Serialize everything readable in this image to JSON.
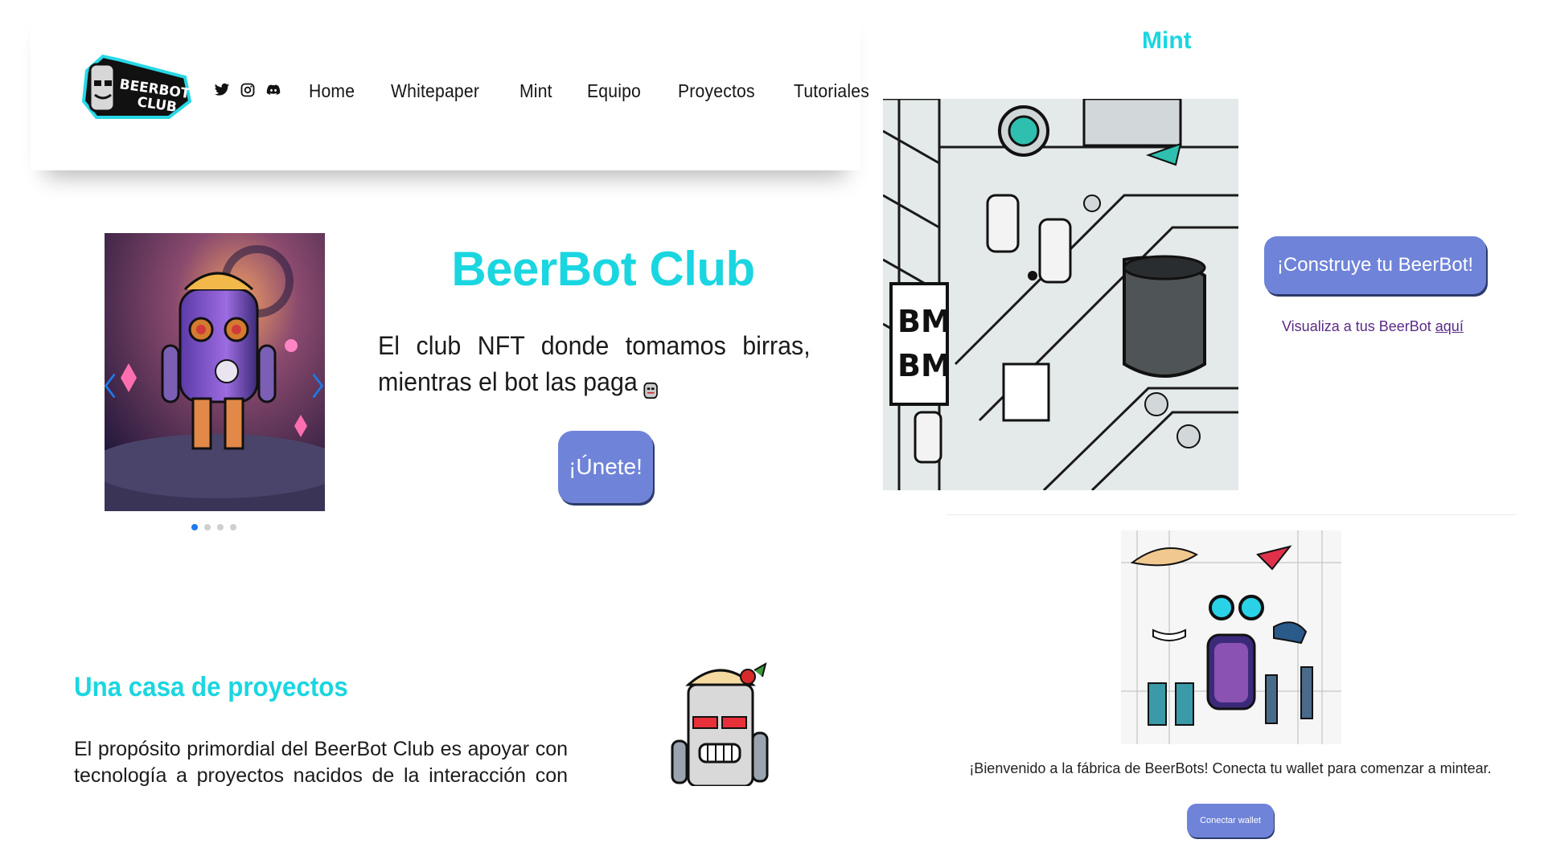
{
  "brand": {
    "logo_text_line1": "BEERBOT",
    "logo_text_line2": "CLUB"
  },
  "social": {
    "icons": [
      "twitter-icon",
      "instagram-icon",
      "discord-icon"
    ]
  },
  "nav": {
    "items": [
      "Home",
      "Whitepaper",
      "Mint",
      "Equipo",
      "Proyectos",
      "Tutoriales"
    ]
  },
  "hero": {
    "title": "BeerBot Club",
    "text": "El club NFT donde tomamos birras, mientras el bot las paga",
    "join_label": "¡Únete!"
  },
  "carousel": {
    "slide_count": 4,
    "active_slide": 1
  },
  "section": {
    "title": "Una casa de proyectos",
    "text": "El propósito primordial del BeerBot Club es apoyar con tecnología a proyectos nacidos de la interacción con su"
  },
  "mint": {
    "title": "Mint",
    "build_label": "¡Construye tu BeerBot!",
    "visualize_text": "Visualiza a tus BeerBot ",
    "visualize_link": "aquí",
    "welcome_text": "¡Bienvenido a la fábrica de BeerBots! Conecta tu wallet para comenzar a mintear.",
    "wallet_label": "Conectar wallet"
  },
  "colors": {
    "accent": "#1ad6e0",
    "button": "#6f83d8",
    "link": "#5b2a86",
    "carousel_dot_active": "#1d7bea"
  }
}
